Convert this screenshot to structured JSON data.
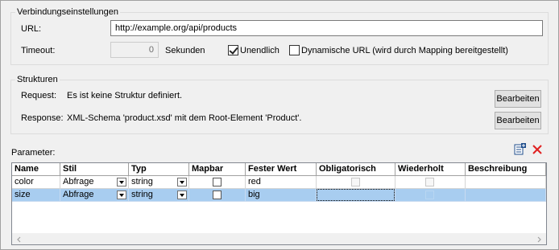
{
  "connection": {
    "group_title": "Verbindungseinstellungen",
    "url_label": "URL:",
    "url_value": "http://example.org/api/products",
    "timeout_label": "Timeout:",
    "timeout_value": "0",
    "timeout_unit": "Sekunden",
    "infinite_label": "Unendlich",
    "infinite_checked": true,
    "dynamic_url_label": "Dynamische URL (wird durch Mapping bereitgestellt)",
    "dynamic_url_checked": false
  },
  "structures": {
    "group_title": "Strukturen",
    "request_label": "Request:",
    "request_value": "Es ist keine Struktur definiert.",
    "request_button": "Bearbeiten",
    "response_label": "Response:",
    "response_value": "XML-Schema 'product.xsd' mit dem Root-Element 'Product'.",
    "response_button": "Bearbeiten"
  },
  "parameters": {
    "label": "Parameter:",
    "columns": [
      "Name",
      "Stil",
      "Typ",
      "Mapbar",
      "Fester Wert",
      "Obligatorisch",
      "Wiederholt",
      "Beschreibung"
    ],
    "rows": [
      {
        "name": "color",
        "stil": "Abfrage",
        "typ": "string",
        "mapbar": false,
        "fester_wert": "red",
        "obligatorisch": false,
        "wiederholt": false,
        "beschreibung": "",
        "selected": false
      },
      {
        "name": "size",
        "stil": "Abfrage",
        "typ": "string",
        "mapbar": false,
        "fester_wert": "big",
        "obligatorisch": false,
        "wiederholt": false,
        "beschreibung": "",
        "selected": true
      }
    ]
  },
  "icons": {
    "add_parameter": "add-parameter-icon",
    "delete_parameter": "delete-icon",
    "delete_color": "#e02020"
  }
}
